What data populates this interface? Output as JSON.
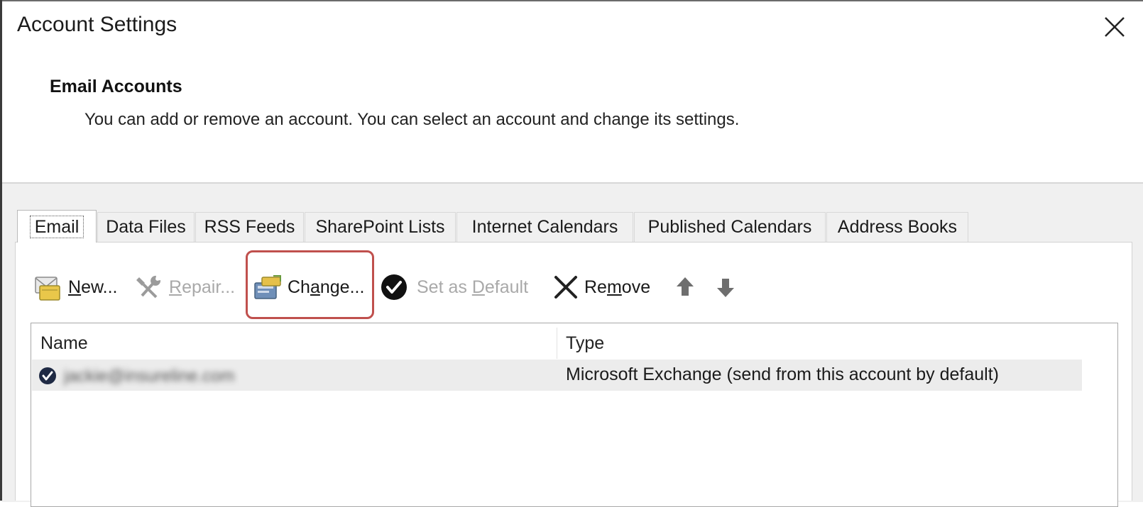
{
  "window": {
    "title": "Account Settings"
  },
  "header": {
    "title": "Email Accounts",
    "description": "You can add or remove an account. You can select an account and change its settings."
  },
  "tabs": [
    {
      "label": "Email",
      "active": true
    },
    {
      "label": "Data Files"
    },
    {
      "label": "RSS Feeds"
    },
    {
      "label": "SharePoint Lists"
    },
    {
      "label": "Internet Calendars"
    },
    {
      "label": "Published Calendars"
    },
    {
      "label": "Address Books"
    }
  ],
  "toolbar": {
    "new": {
      "pre": "",
      "key": "N",
      "post": "ew...",
      "icon": "new-account-icon"
    },
    "repair": {
      "pre": "",
      "key": "R",
      "post": "epair...",
      "icon": "repair-tools-icon",
      "disabled": true
    },
    "change": {
      "pre": "Ch",
      "key": "a",
      "post": "nge...",
      "icon": "change-account-icon"
    },
    "set_default": {
      "pre": "Set as ",
      "key": "D",
      "post": "efault",
      "icon": "checkmark-circle-icon",
      "disabled": true
    },
    "remove": {
      "pre": "Re",
      "key": "m",
      "post": "ove",
      "icon": "remove-x-icon"
    },
    "move_up_icon": "arrow-up-icon",
    "move_down_icon": "arrow-down-icon"
  },
  "accounts": {
    "columns": {
      "name": "Name",
      "type": "Type"
    },
    "rows": [
      {
        "name": "jackie@insureline.com",
        "type": "Microsoft Exchange (send from this account by default)",
        "is_default": true
      }
    ]
  },
  "colors": {
    "highlight": "#c0504d",
    "panel_background": "#f0f0f0",
    "selected_row": "#ececec"
  }
}
